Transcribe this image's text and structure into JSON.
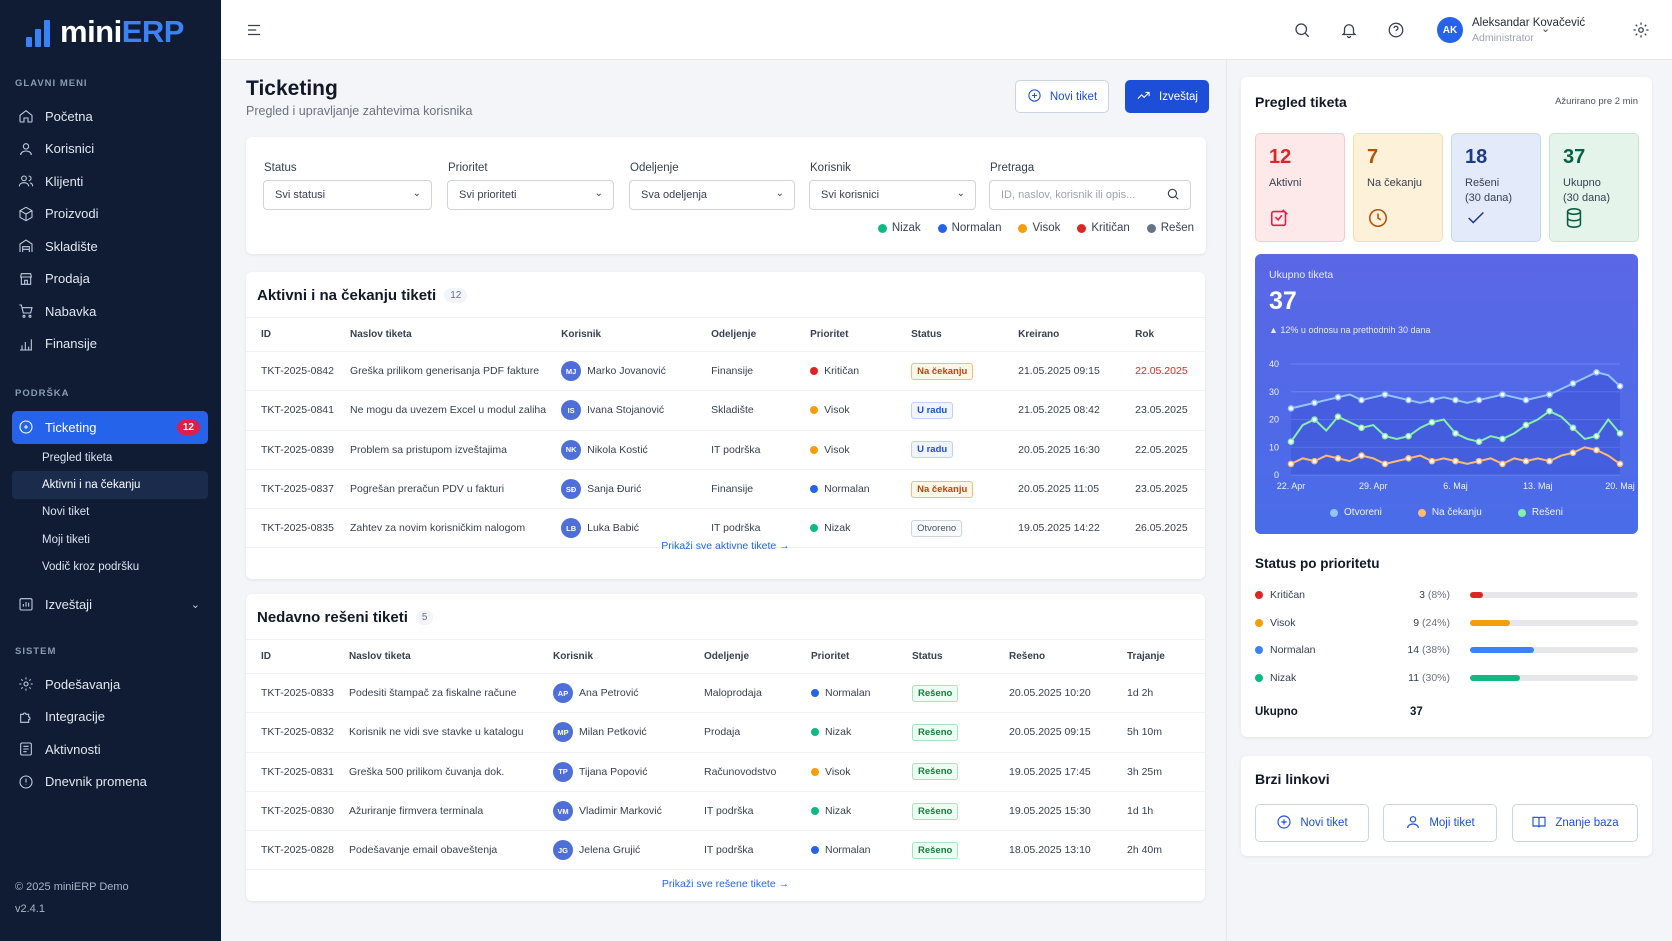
{
  "app": {
    "name_main": "mini",
    "name_accent": "ERP"
  },
  "sidebar": {
    "main_title": "GLAVNI MENI",
    "main_items": [
      {
        "label": "Početna",
        "icon": "home-icon"
      },
      {
        "label": "Korisnici",
        "icon": "user-icon"
      },
      {
        "label": "Klijenti",
        "icon": "users-icon"
      },
      {
        "label": "Proizvodi",
        "icon": "box-icon"
      },
      {
        "label": "Skladište",
        "icon": "warehouse-icon"
      },
      {
        "label": "Prodaja",
        "icon": "store-icon"
      },
      {
        "label": "Nabavka",
        "icon": "cart-icon"
      },
      {
        "label": "Finansije",
        "icon": "bar-chart-icon"
      }
    ],
    "support_title": "PODRŠKA",
    "ticketing": {
      "label": "Ticketing",
      "count": "12"
    },
    "ticketing_sub": [
      "Pregled tiketa",
      "Aktivni i na čekanju",
      "Novi tiket",
      "Moji tiketi",
      "Vodič kroz podršku"
    ],
    "reports_label": "Izveštaji",
    "system_title": "SISTEM",
    "system_items": [
      {
        "label": "Podešavanja",
        "icon": "gear-icon"
      },
      {
        "label": "Integracije",
        "icon": "puzzle-icon"
      },
      {
        "label": "Aktivnosti",
        "icon": "activity-icon"
      },
      {
        "label": "Dnevnik promena",
        "icon": "info-icon"
      }
    ],
    "copyright": "© 2025 miniERP Demo",
    "version": "v2.4.1"
  },
  "user": {
    "initials": "AK",
    "name": "Aleksandar Kovačević",
    "role": "Administrator"
  },
  "page": {
    "title": "Ticketing",
    "subtitle": "Pregled i upravljanje zahtevima korisnika",
    "new_ticket": "Novi tiket",
    "report": "Izveštaj"
  },
  "filters": {
    "status": {
      "label": "Status",
      "value": "Svi statusi"
    },
    "priority": {
      "label": "Prioritet",
      "value": "Svi prioriteti"
    },
    "department": {
      "label": "Odeljenje",
      "value": "Sva odeljenja"
    },
    "user": {
      "label": "Korisnik",
      "value": "Svi korisnici"
    },
    "search": {
      "label": "Pretraga",
      "placeholder": "ID, naslov, korisnik ili opis..."
    }
  },
  "legend": [
    {
      "label": "Nizak",
      "color": "#10b981"
    },
    {
      "label": "Normalan",
      "color": "#2563eb"
    },
    {
      "label": "Visok",
      "color": "#f59e0b"
    },
    {
      "label": "Kritičan",
      "color": "#dc2626"
    },
    {
      "label": "Rešen",
      "color": "#64748b"
    }
  ],
  "active_section": {
    "title": "Aktivni i na čekanju tiketi",
    "count": "12",
    "columns": [
      "ID",
      "Naslov tiketa",
      "Korisnik",
      "Odeljenje",
      "Prioritet",
      "Status",
      "Kreirano",
      "Rok"
    ],
    "rows": [
      {
        "id": "TKT-2025-0842",
        "title": "Greška prilikom generisanja PDF fakture",
        "initials": "MJ",
        "user": "Marko Jovanović",
        "dept": "Finansije",
        "priority": "Kritičan",
        "pcolor": "#dc2626",
        "status": "Na čekanju",
        "stype": "wait",
        "created": "21.05.2025 09:15",
        "due": "22.05.2025",
        "overdue": true
      },
      {
        "id": "TKT-2025-0841",
        "title": "Ne mogu da uvezem Excel u modul zaliha",
        "initials": "IS",
        "user": "Ivana Stojanović",
        "dept": "Skladište",
        "priority": "Visok",
        "pcolor": "#f59e0b",
        "status": "U radu",
        "stype": "work",
        "created": "21.05.2025 08:42",
        "due": "23.05.2025",
        "overdue": false
      },
      {
        "id": "TKT-2025-0839",
        "title": "Problem sa pristupom izveštajima",
        "initials": "NK",
        "user": "Nikola Kostić",
        "dept": "IT podrška",
        "priority": "Visok",
        "pcolor": "#f59e0b",
        "status": "U radu",
        "stype": "work",
        "created": "20.05.2025 16:30",
        "due": "22.05.2025",
        "overdue": false
      },
      {
        "id": "TKT-2025-0837",
        "title": "Pogrešan preračun PDV u fakturi",
        "initials": "SĐ",
        "user": "Sanja Đurić",
        "dept": "Finansije",
        "priority": "Normalan",
        "pcolor": "#2563eb",
        "status": "Na čekanju",
        "stype": "wait",
        "created": "20.05.2025 11:05",
        "due": "23.05.2025",
        "overdue": false
      },
      {
        "id": "TKT-2025-0835",
        "title": "Zahtev za novim korisničkim nalogom",
        "initials": "LB",
        "user": "Luka Babić",
        "dept": "IT podrška",
        "priority": "Nizak",
        "pcolor": "#10b981",
        "status": "Otvoreno",
        "stype": "open",
        "created": "19.05.2025 14:22",
        "due": "26.05.2025",
        "overdue": false
      }
    ],
    "show_all": "Prikaži sve aktivne tikete →"
  },
  "resolved_section": {
    "title": "Nedavno rešeni tiketi",
    "count": "5",
    "columns": [
      "ID",
      "Naslov tiketa",
      "Korisnik",
      "Odeljenje",
      "Prioritet",
      "Status",
      "Rešeno",
      "Trajanje"
    ],
    "rows": [
      {
        "id": "TKT-2025-0833",
        "title": "Podesiti štampač za fiskalne račune",
        "initials": "AP",
        "user": "Ana Petrović",
        "dept": "Maloprodaja",
        "priority": "Normalan",
        "pcolor": "#2563eb",
        "status": "Rešeno",
        "resolved": "20.05.2025 10:20",
        "duration": "1d 2h"
      },
      {
        "id": "TKT-2025-0832",
        "title": "Korisnik ne vidi sve stavke u katalogu",
        "initials": "MP",
        "user": "Milan Petković",
        "dept": "Prodaja",
        "priority": "Nizak",
        "pcolor": "#10b981",
        "status": "Rešeno",
        "resolved": "20.05.2025 09:15",
        "duration": "5h 10m"
      },
      {
        "id": "TKT-2025-0831",
        "title": "Greška 500 prilikom čuvanja dok.",
        "initials": "TP",
        "user": "Tijana Popović",
        "dept": "Računovodstvo",
        "priority": "Visok",
        "pcolor": "#f59e0b",
        "status": "Rešeno",
        "resolved": "19.05.2025 17:45",
        "duration": "3h 25m"
      },
      {
        "id": "TKT-2025-0830",
        "title": "Ažuriranje firmvera terminala",
        "initials": "VM",
        "user": "Vladimir Marković",
        "dept": "IT podrška",
        "priority": "Nizak",
        "pcolor": "#10b981",
        "status": "Rešeno",
        "resolved": "19.05.2025 15:30",
        "duration": "1d 1h"
      },
      {
        "id": "TKT-2025-0828",
        "title": "Podešavanje email obaveštenja",
        "initials": "JG",
        "user": "Jelena Grujić",
        "dept": "IT podrška",
        "priority": "Normalan",
        "pcolor": "#2563eb",
        "status": "Rešeno",
        "resolved": "18.05.2025 13:10",
        "duration": "2h 40m"
      }
    ],
    "show_all": "Prikaži sve rešene tikete →"
  },
  "overview": {
    "title": "Pregled tiketa",
    "updated": "Ažurirano pre 2 min",
    "stats": [
      {
        "num": "12",
        "label": "Aktivni",
        "color": "#dc2626",
        "bg": "#fde8ea",
        "icon": "alert-icon"
      },
      {
        "num": "7",
        "label": "Na čekanju",
        "color": "#b45309",
        "bg": "#fdf1d9",
        "icon": "clock-icon"
      },
      {
        "num": "18",
        "label": "Rešeni\n(30 dana)",
        "color": "#1e3a8a",
        "bg": "#e3ebfb",
        "icon": "check-icon"
      },
      {
        "num": "37",
        "label": "Ukupno\n(30 dana)",
        "color": "#065f46",
        "bg": "#e5f4ea",
        "icon": "database-icon"
      }
    ],
    "total_label": "Ukupno tiketa",
    "total_value": "37",
    "total_change": "12% u odnosu na prethodnih 30 dana"
  },
  "chart_data": {
    "type": "line",
    "x": [
      "22. Apr",
      "23. Apr",
      "24. Apr",
      "25. Apr",
      "26. Apr",
      "27. Apr",
      "28. Apr",
      "29. Apr",
      "30. Apr",
      "1. Maj",
      "2. Maj",
      "3. Maj",
      "4. Maj",
      "5. Maj",
      "6. Maj",
      "7. Maj",
      "8. Maj",
      "9. Maj",
      "10. Maj",
      "11. Maj",
      "12. Maj",
      "13. Maj",
      "14. Maj",
      "15. Maj",
      "16. Maj",
      "17. Maj",
      "18. Maj",
      "19. Maj",
      "20. Maj"
    ],
    "x_ticks": [
      "22. Apr",
      "29. Apr",
      "6. Maj",
      "13. Maj",
      "20. Maj"
    ],
    "ylim": [
      0,
      40
    ],
    "y_ticks": [
      "0",
      "10",
      "20",
      "30",
      "40"
    ],
    "series": [
      {
        "name": "Otvoreni",
        "color": "#93c5fd",
        "values": [
          24,
          25,
          26,
          27,
          28,
          29,
          27,
          28,
          29,
          28,
          27,
          26,
          27,
          28,
          27,
          26,
          27,
          28,
          29,
          28,
          27,
          28,
          29,
          31,
          33,
          35,
          37,
          36,
          32
        ]
      },
      {
        "name": "Na čekanju",
        "color": "#fdba74",
        "values": [
          4,
          6,
          5,
          7,
          6,
          5,
          7,
          6,
          4,
          5,
          6,
          7,
          5,
          6,
          5,
          4,
          5,
          6,
          4,
          6,
          5,
          6,
          5,
          7,
          8,
          10,
          9,
          7,
          4
        ]
      },
      {
        "name": "Rešeni",
        "color": "#86efac",
        "values": [
          12,
          18,
          20,
          16,
          21,
          19,
          17,
          18,
          14,
          13,
          14,
          17,
          19,
          20,
          15,
          13,
          12,
          14,
          13,
          15,
          18,
          20,
          23,
          21,
          17,
          13,
          14,
          20,
          15
        ]
      }
    ]
  },
  "priority_status": {
    "title": "Status po prioritetu",
    "items": [
      {
        "label": "Kritičan",
        "count": "3",
        "pct": "(8%)",
        "value": 8,
        "color": "#dc2626"
      },
      {
        "label": "Visok",
        "count": "9",
        "pct": "(24%)",
        "value": 24,
        "color": "#f59e0b"
      },
      {
        "label": "Normalan",
        "count": "14",
        "pct": "(38%)",
        "value": 38,
        "color": "#3b82f6"
      },
      {
        "label": "Nizak",
        "count": "11",
        "pct": "(30%)",
        "value": 30,
        "color": "#10b981"
      }
    ],
    "total_label": "Ukupno",
    "total_value": "37"
  },
  "quick_links": {
    "title": "Brzi linkovi",
    "new_ticket": "Novi tiket",
    "my_ticket": "Moji tiket",
    "knowledge": "Znanje baza"
  }
}
